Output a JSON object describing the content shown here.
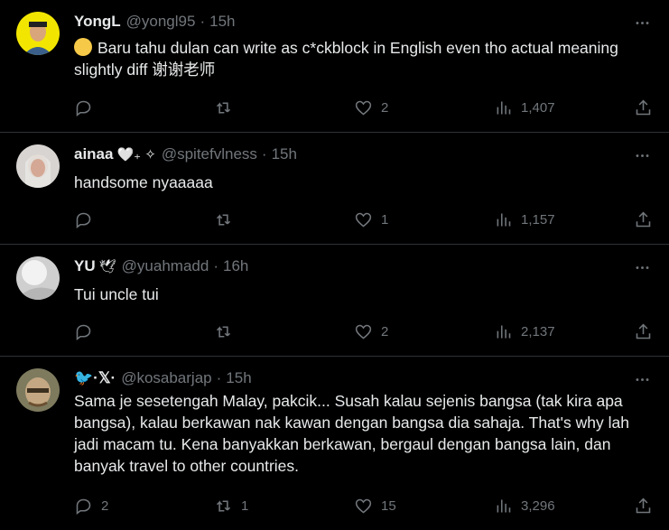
{
  "tweets": [
    {
      "name": "YongL",
      "badge": "",
      "handle": "@yongl95",
      "time": "15h",
      "text": "Baru tahu dulan can write as c*ckblock in English even tho actual meaning slightly diff 谢谢老师",
      "emoji": "rolling-on-floor-laughing",
      "replies": "",
      "retweets": "",
      "likes": "2",
      "views": "1,407"
    },
    {
      "name": "ainaa",
      "badge": "🤍₊ ✧",
      "handle": "@spitefvlness",
      "time": "15h",
      "text": "handsome nyaaaaa",
      "replies": "",
      "retweets": "",
      "likes": "1",
      "views": "1,157"
    },
    {
      "name": "YU",
      "badge": "🕊",
      "handle": "@yuahmadd",
      "time": "16h",
      "text": "Tui uncle tui",
      "replies": "",
      "retweets": "",
      "likes": "2",
      "views": "2,137"
    },
    {
      "name": "🐦·𝕏·",
      "badge": "",
      "handle": "@kosabarjap",
      "time": "15h",
      "text": "Sama je sesetengah Malay, pakcik... Susah kalau sejenis bangsa (tak kira apa bangsa), kalau berkawan nak kawan dengan bangsa dia sahaja. That's why lah jadi macam tu. Kena banyakkan berkawan, bergaul dengan bangsa lain, dan banyak travel to other countries.",
      "replies": "2",
      "retweets": "1",
      "likes": "15",
      "views": "3,296"
    }
  ],
  "dot": "·",
  "colors": {
    "background": "#000000",
    "text": "#e7e9ea",
    "muted": "#71767b",
    "divider": "#2f3336"
  }
}
